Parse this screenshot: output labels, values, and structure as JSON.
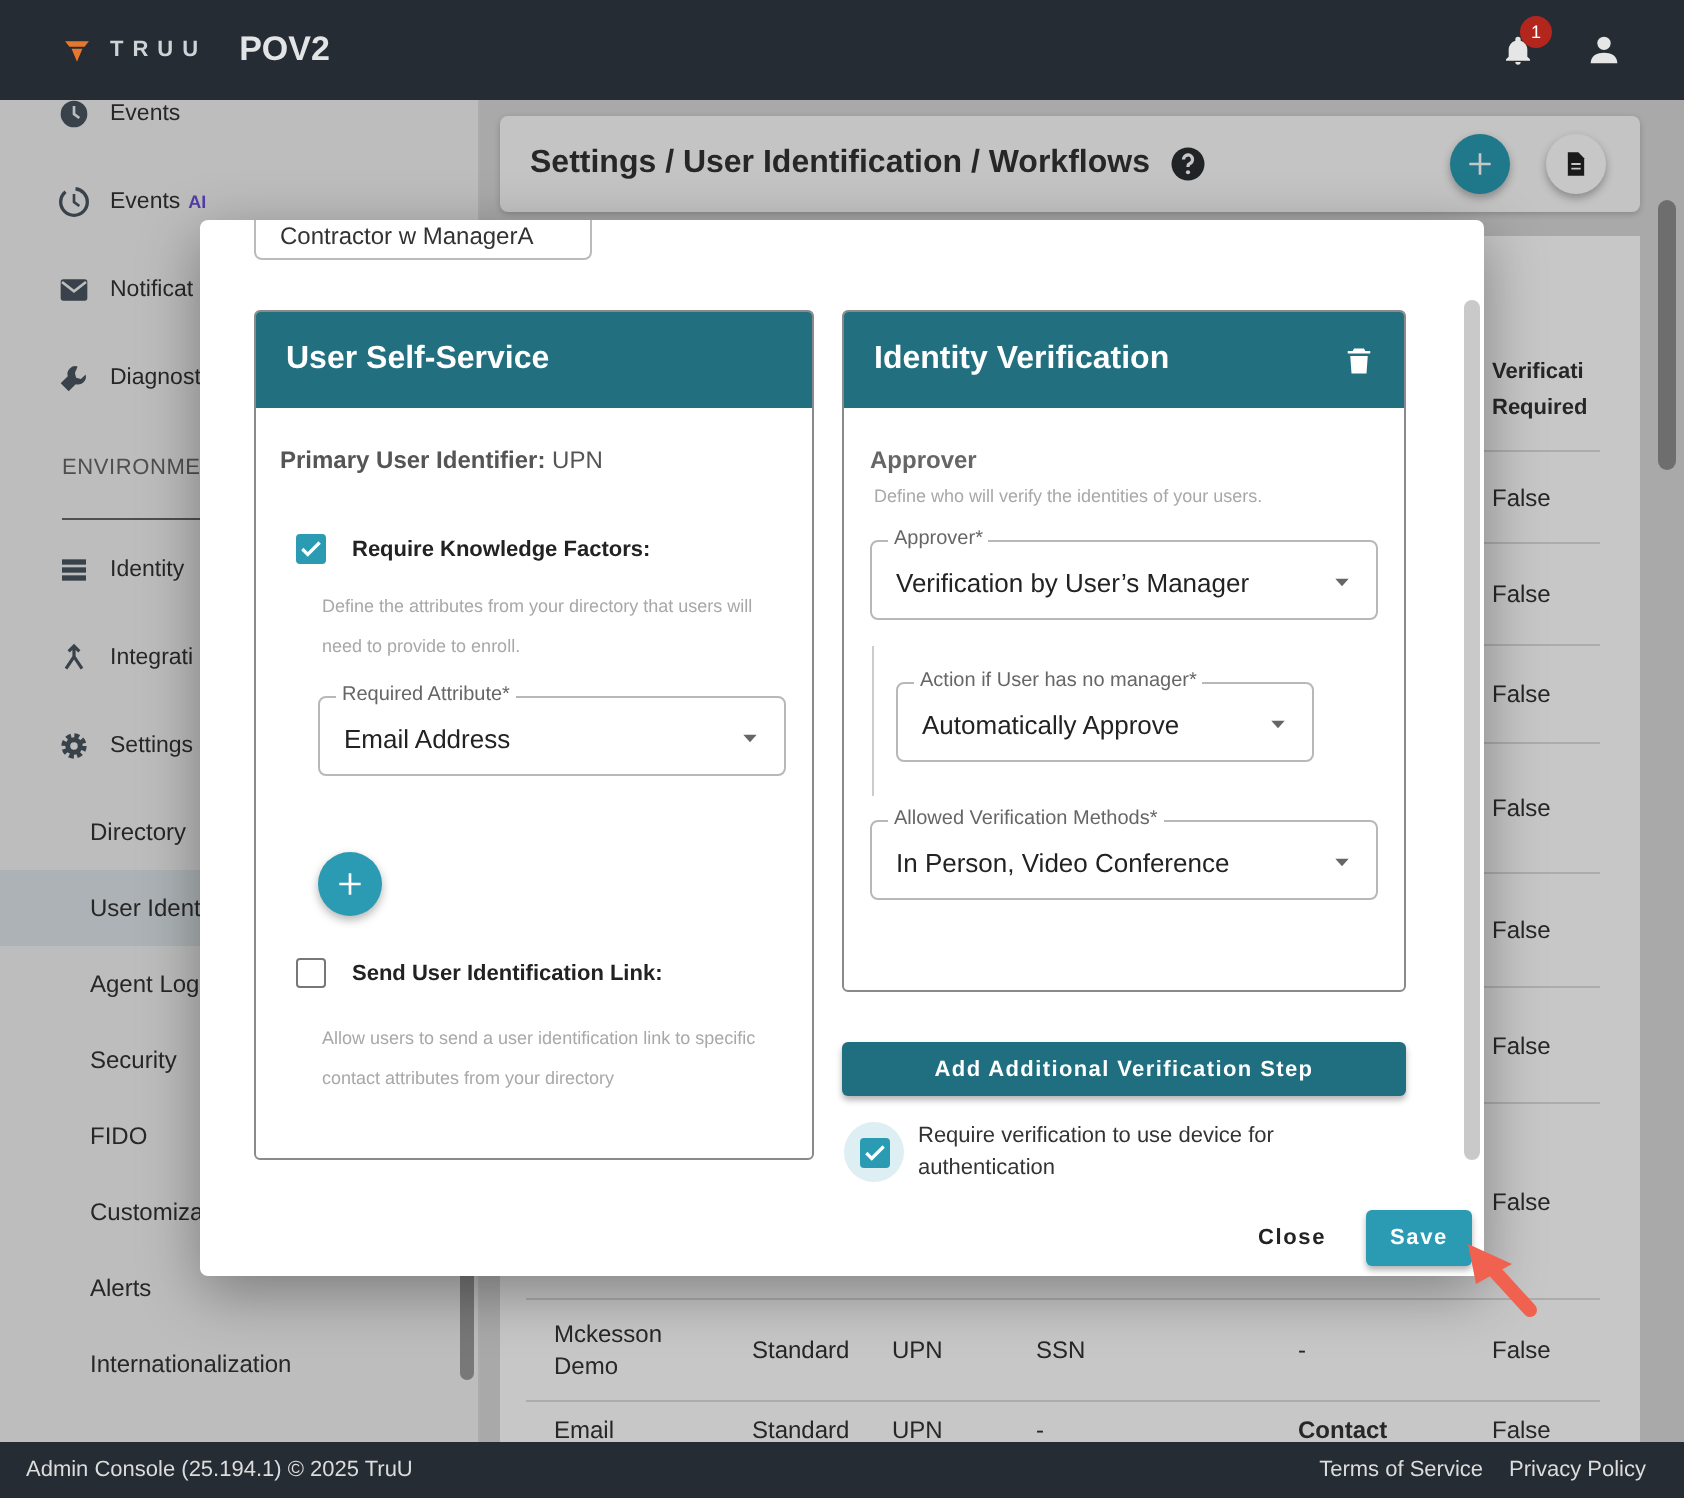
{
  "top_bar": {
    "logo": "TRUU",
    "title": "POV2",
    "notification_count": "1"
  },
  "sidebar": {
    "items": [
      {
        "kind": "nav",
        "label": "Events",
        "selected": false
      },
      {
        "kind": "nav",
        "label": "Events",
        "tag": "AI",
        "selected": false
      },
      {
        "kind": "nav",
        "label": "Notificat",
        "selected": false
      },
      {
        "kind": "nav",
        "label": "Diagnost",
        "selected": false
      },
      {
        "kind": "section",
        "label": "ENVIRONME"
      },
      {
        "kind": "nav",
        "label": "Identity",
        "selected": false
      },
      {
        "kind": "nav",
        "label": "Integrati",
        "selected": false
      },
      {
        "kind": "nav",
        "label": "Settings",
        "selected": false
      },
      {
        "kind": "sub",
        "label": "Directory",
        "selected": false
      },
      {
        "kind": "sub",
        "label": "User Ident",
        "selected": true
      },
      {
        "kind": "sub",
        "label": "Agent Log",
        "selected": false
      },
      {
        "kind": "sub",
        "label": "Security",
        "selected": false
      },
      {
        "kind": "sub",
        "label": "FIDO",
        "selected": false
      },
      {
        "kind": "sub",
        "label": "Customiza",
        "selected": false
      },
      {
        "kind": "sub",
        "label": "Alerts",
        "selected": false
      },
      {
        "kind": "sub",
        "label": "Internationalization",
        "selected": false
      }
    ]
  },
  "page": {
    "breadcrumb": "Settings / User Identification / Workflows",
    "table": {
      "columns": [
        "Verificati Required"
      ],
      "rows": [
        {
          "cells": [
            "False"
          ]
        },
        {
          "cells": [
            "False"
          ]
        },
        {
          "cells": [
            "False"
          ]
        },
        {
          "cells": [
            "False"
          ]
        },
        {
          "cells": [
            "False"
          ]
        },
        {
          "cells": [
            "False"
          ]
        },
        {
          "cells": [
            "False"
          ]
        },
        {
          "cells": [
            "Mckesson Demo",
            "Standard",
            "UPN",
            "SSN",
            "-",
            "False"
          ]
        },
        {
          "cells": [
            "Email",
            "Standard",
            "UPN",
            "-",
            "**Contact**",
            "False"
          ]
        }
      ]
    }
  },
  "dialog": {
    "workflow_name": "Contractor w ManagerA",
    "self_service": {
      "title": "User Self-Service",
      "primary_identifier": "**Primary User Identifier:** UPN",
      "options": [
        {
          "label": "Require Knowledge Factors:",
          "checked": true,
          "hint": "Define the attributes from your directory that users will need to provide to enroll.",
          "fields": [
            {
              "label": "Required Attribute*",
              "value": "Email Address"
            }
          ]
        },
        {
          "label": "Send User Identification Link:",
          "checked": false,
          "hint": "Allow users to send a user identification link to specific contact attributes from your directory"
        }
      ]
    },
    "verification": {
      "title": "Identity Verification",
      "section": "Approver",
      "hint": "Define who will verify the identities of your users.",
      "fields": [
        {
          "label": "Approver*",
          "value": "Verification by User’s Manager",
          "children": [
            {
              "label": "Action if User has no manager*",
              "value": "Automatically Approve"
            }
          ]
        },
        {
          "label": "Allowed Verification Methods*",
          "value": "In Person, Video Conference"
        }
      ]
    },
    "add_step_button": "Add Additional Verification Step",
    "device_verification": {
      "label": "Require verification to use device for authentication",
      "checked": true
    },
    "buttons": [
      {
        "kind": "text",
        "label": "Close"
      },
      {
        "kind": "primary",
        "label": "Save"
      }
    ]
  },
  "footer": {
    "copyright": "Admin Console (25.194.1) © 2025 TruU",
    "links": [
      "Terms of Service",
      "Privacy Policy"
    ]
  }
}
